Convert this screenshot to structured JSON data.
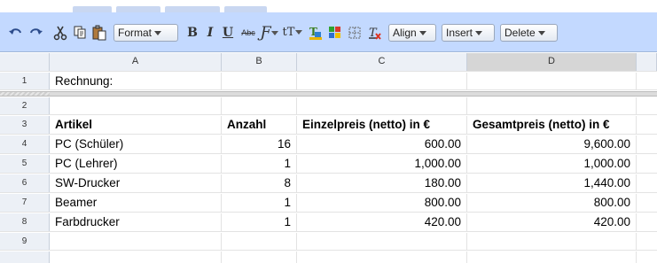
{
  "toolbar": {
    "undo_icon": "undo-icon",
    "redo_icon": "redo-icon",
    "format_label": "Format",
    "bold_glyph": "B",
    "italic_glyph": "I",
    "underline_glyph": "U",
    "strike_glyph": "Abc",
    "fontfamily_glyph": "Ƒ",
    "fontsize_glyph": "tT",
    "align_label": "Align",
    "insert_label": "Insert",
    "delete_label": "Delete"
  },
  "columns": [
    "A",
    "B",
    "C",
    "D"
  ],
  "selected_column": "D",
  "rows": [
    {
      "n": "1",
      "a": "Rechnung:",
      "b": "",
      "c": "",
      "d": ""
    },
    {
      "n": "2",
      "a": "",
      "b": "",
      "c": "",
      "d": ""
    },
    {
      "n": "3",
      "a": "Artikel",
      "b": "Anzahl",
      "c": "Einzelpreis (netto) in €",
      "d": "Gesamtpreis (netto) in €"
    },
    {
      "n": "4",
      "a": "PC (Schüler)",
      "b": "16",
      "c": "600.00",
      "d": "9,600.00"
    },
    {
      "n": "5",
      "a": "PC (Lehrer)",
      "b": "1",
      "c": "1,000.00",
      "d": "1,000.00"
    },
    {
      "n": "6",
      "a": "SW-Drucker",
      "b": "8",
      "c": "180.00",
      "d": "1,440.00"
    },
    {
      "n": "7",
      "a": "Beamer",
      "b": "1",
      "c": "800.00",
      "d": "800.00"
    },
    {
      "n": "8",
      "a": "Farbdrucker",
      "b": "1",
      "c": "420.00",
      "d": "420.00"
    },
    {
      "n": "9",
      "a": "",
      "b": "",
      "c": "",
      "d": ""
    }
  ]
}
